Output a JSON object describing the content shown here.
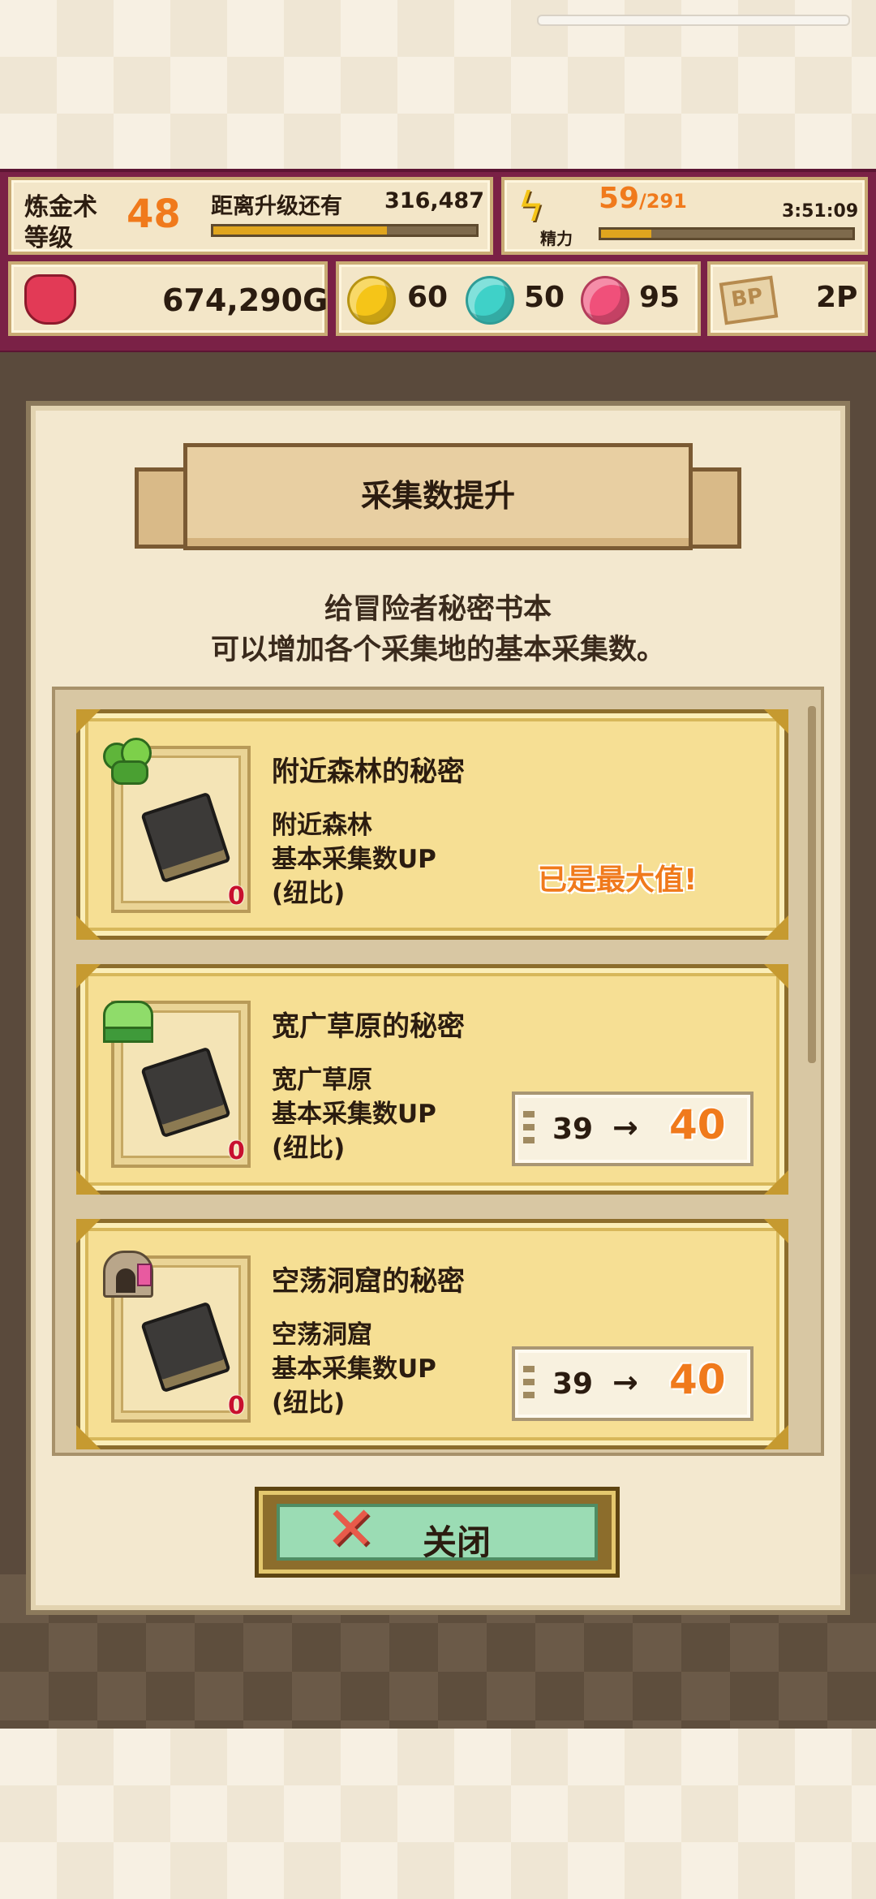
{
  "colors": {
    "hud_bg": "#7a2146",
    "accent_orange": "#f07a1c",
    "card_bg": "#f6df94",
    "gem_yellow": "#f5c518",
    "gem_cyan": "#3fd1c8",
    "gem_pink": "#f0507a"
  },
  "hud": {
    "alchemy_level_label": "炼金术\n等级",
    "alchemy_level_label_line1": "炼金术",
    "alchemy_level_label_line2": "等级",
    "alchemy_level_value": "48",
    "next_level_label": "距离升级还有",
    "next_level_value": "316,487",
    "next_level_progress": 0.66,
    "stamina_icon": "lightning-icon",
    "stamina_label": "精力",
    "stamina_current": "59",
    "stamina_max": "/291",
    "stamina_progress": 0.2,
    "stamina_timer": "3:51:09",
    "gold_icon": "coin-purse-icon",
    "gold_value": "674,290G",
    "gem_yellow_value": "60",
    "gem_cyan_value": "50",
    "gem_pink_value": "95",
    "bp_icon": "bp-icon",
    "bp_icon_text": "BP",
    "bp_value": "2P"
  },
  "dialog": {
    "title": "采集数提升",
    "desc_line1": "给冒险者秘密书本",
    "desc_line2": "可以增加各个采集地的基本采集数。",
    "items": [
      {
        "title": "附近森林的秘密",
        "place": "附近森林",
        "effect": "基本采集数UP",
        "ratio": "(纽比)",
        "count": "0",
        "icon": "forest-icon",
        "status": "已是最大值!"
      },
      {
        "title": "宽广草原的秘密",
        "place": "宽广草原",
        "effect": "基本采集数UP",
        "ratio": "(纽比)",
        "count": "0",
        "icon": "grassland-icon",
        "from": "39",
        "arrow": "→",
        "to": "40"
      },
      {
        "title": "空荡洞窟的秘密",
        "place": "空荡洞窟",
        "effect": "基本采集数UP",
        "ratio": "(纽比)",
        "count": "0",
        "icon": "cave-icon",
        "from": "39",
        "arrow": "→",
        "to": "40"
      }
    ],
    "close_icon": "close-x-icon",
    "close_x": "✕",
    "close_label": "关闭"
  }
}
